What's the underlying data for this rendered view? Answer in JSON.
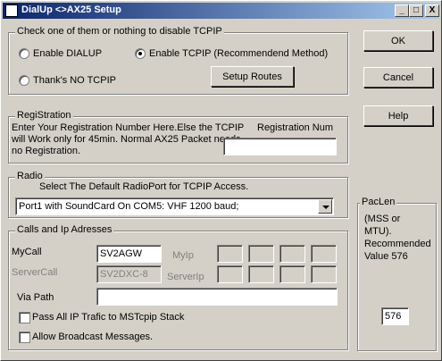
{
  "window": {
    "title": "DialUp <>AX25 Setup",
    "minimize_label": "_",
    "maximize_label": "□",
    "close_label": "X"
  },
  "tcpip_group": {
    "label": "Check one of them or nothing to disable TCPIP",
    "enable_dialup": "Enable DIALUP",
    "enable_tcpip": "Enable TCPIP (Recommendend Method)",
    "no_tcpip": "Thank's NO TCPIP",
    "selected": "enable_tcpip",
    "setup_routes": "Setup Routes"
  },
  "registration_group": {
    "label": "RegiStration",
    "info": "Enter Your Registration Number Here.Else the TCPIP will Work only for 45min. Normal AX25 Packet needs no Registration.",
    "field_label": "Registration Num",
    "value": ""
  },
  "radio_group": {
    "label": "Radio",
    "description": "Select The Default RadioPort for TCPIP Access.",
    "selected_port": "Port1 with SoundCard On COM5: VHF 1200 baud;"
  },
  "calls_group": {
    "label": "Calls and Ip Adresses",
    "mycall_label": "MyCall",
    "mycall_value": "SV2AGW",
    "myip_label": "MyIp",
    "servercall_label": "ServerCall",
    "servercall_value": "SV2DXC-8",
    "serverip_label": "ServerIp",
    "via_path_label": "Via Path",
    "via_path_value": "",
    "pass_all_ip": "Pass All IP Trafic to MSTcpip Stack",
    "allow_broadcast": "Allow Broadcast Messages."
  },
  "buttons": {
    "ok": "OK",
    "cancel": "Cancel",
    "help": "Help"
  },
  "paclen_group": {
    "label": "PacLen",
    "note": "(MSS or MTU). Recommended Value 576",
    "value": "576"
  }
}
